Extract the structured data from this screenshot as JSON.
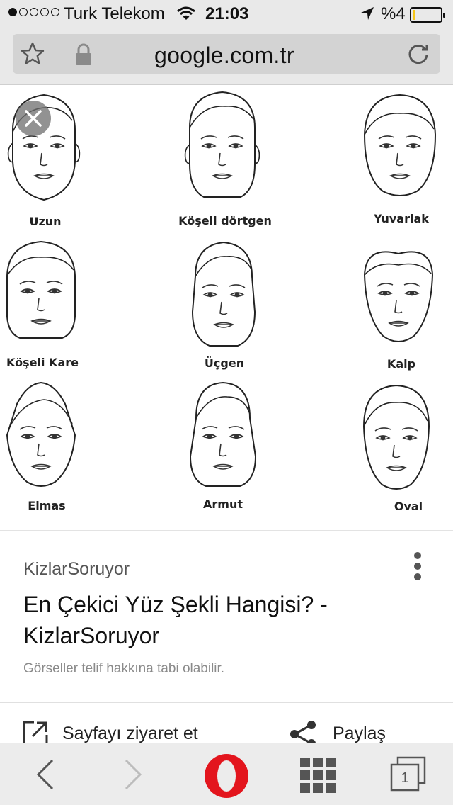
{
  "status_bar": {
    "carrier": "Turk Telekom",
    "time": "21:03",
    "battery": "%4",
    "battery_level": 0.04
  },
  "address_bar": {
    "url": "google.com.tr"
  },
  "face_shapes": [
    "Uzun",
    "Köşeli dörtgen",
    "Yuvarlak",
    "Köşeli Kare",
    "Üçgen",
    "Kalp",
    "Elmas",
    "Armut",
    "Oval"
  ],
  "card": {
    "source": "KizlarSoruyor",
    "title": "En Çekici Yüz Şekli Hangisi? - KizlarSoruyor",
    "copyright": "Görseller telif hakkına tabi olabilir.",
    "visit_label": "Sayfayı ziyaret et",
    "share_label": "Paylaş"
  },
  "toolbar": {
    "tabs_count": "1",
    "brand_color": "#e3151d"
  },
  "icons": [
    "star-icon",
    "lock-icon",
    "reload-icon",
    "close-icon",
    "more-icon",
    "open-external-icon",
    "share-icon",
    "back-icon",
    "forward-icon",
    "opera-icon",
    "speed-dial-icon",
    "tabs-icon"
  ]
}
